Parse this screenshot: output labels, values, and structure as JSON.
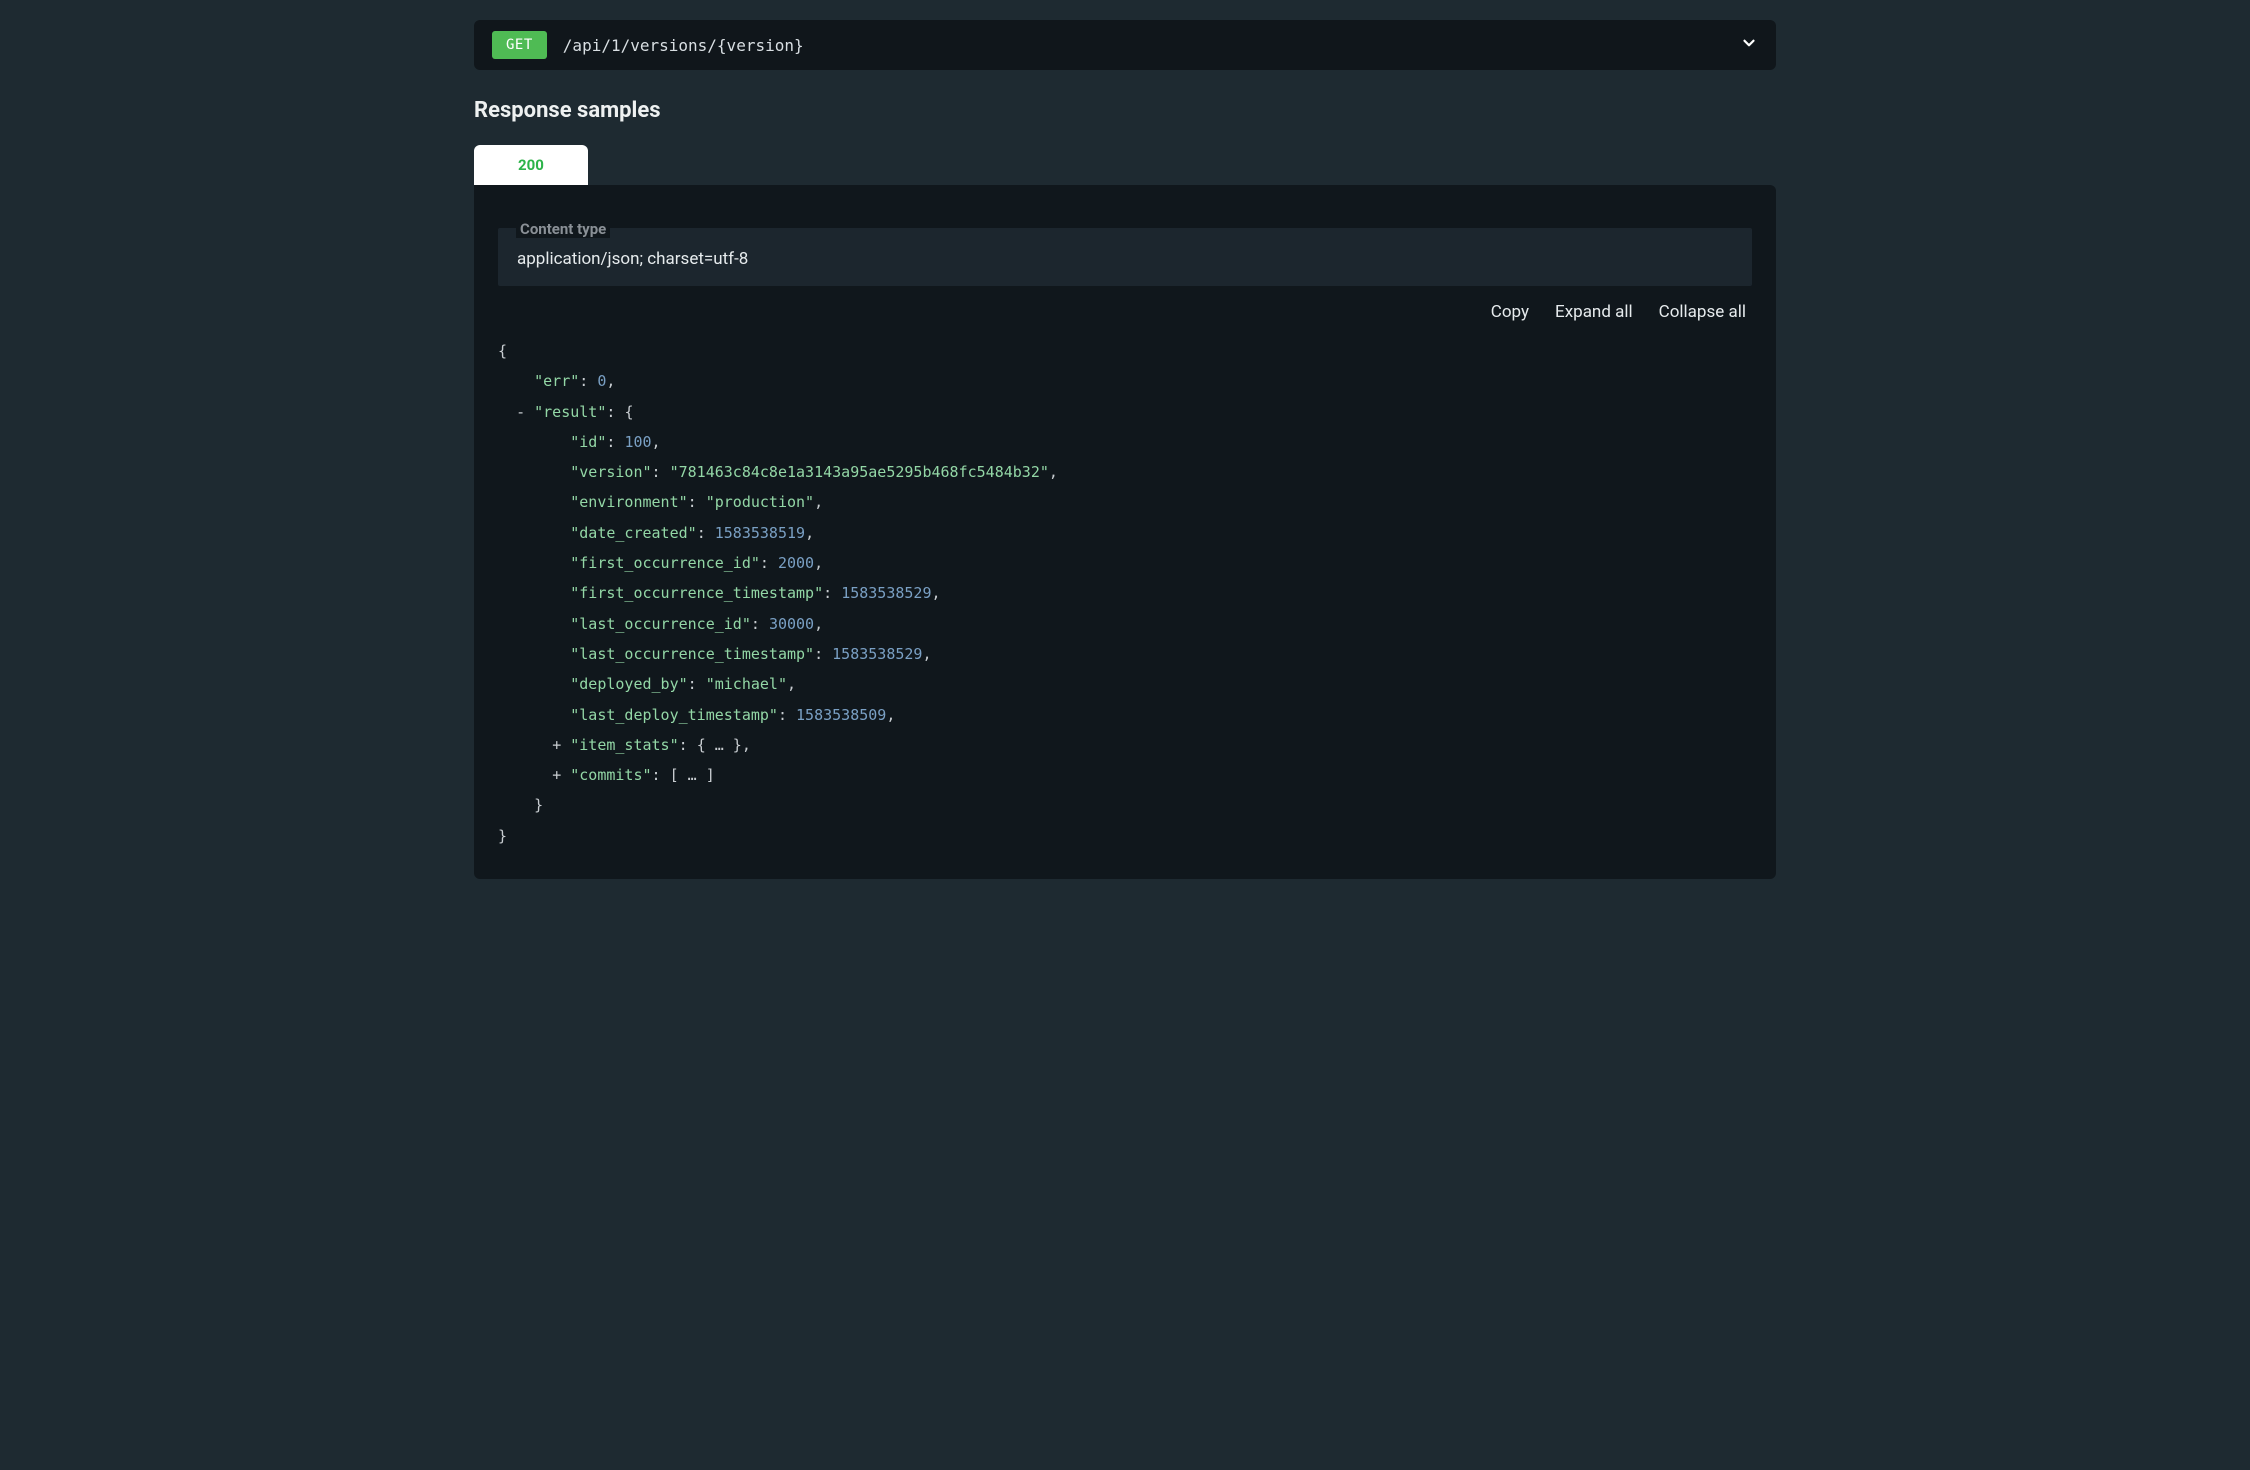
{
  "endpoint": {
    "method": "GET",
    "path": "/api/1/versions/{version}"
  },
  "section_title": "Response samples",
  "tab_label": "200",
  "content_type": {
    "label": "Content type",
    "value": "application/json; charset=utf-8"
  },
  "actions": {
    "copy": "Copy",
    "expand": "Expand all",
    "collapse": "Collapse all"
  },
  "json_sample": {
    "err_key": "\"err\"",
    "err_val": "0",
    "result_key": "\"result\"",
    "id_key": "\"id\"",
    "id_val": "100",
    "version_key": "\"version\"",
    "version_val": "\"781463c84c8e1a3143a95ae5295b468fc5484b32\"",
    "environment_key": "\"environment\"",
    "environment_val": "\"production\"",
    "date_created_key": "\"date_created\"",
    "date_created_val": "1583538519",
    "first_occ_id_key": "\"first_occurrence_id\"",
    "first_occ_id_val": "2000",
    "first_occ_ts_key": "\"first_occurrence_timestamp\"",
    "first_occ_ts_val": "1583538529",
    "last_occ_id_key": "\"last_occurrence_id\"",
    "last_occ_id_val": "30000",
    "last_occ_ts_key": "\"last_occurrence_timestamp\"",
    "last_occ_ts_val": "1583538529",
    "deployed_by_key": "\"deployed_by\"",
    "deployed_by_val": "\"michael\"",
    "last_deploy_ts_key": "\"last_deploy_timestamp\"",
    "last_deploy_ts_val": "1583538509",
    "item_stats_key": "\"item_stats\"",
    "item_stats_collapsed": "{ … }",
    "commits_key": "\"commits\"",
    "commits_collapsed": "[ … ]",
    "minus": "-",
    "plus": "+",
    "open_brace": "{",
    "close_brace": "}",
    "comma": ",",
    "colon_sp": ": "
  }
}
